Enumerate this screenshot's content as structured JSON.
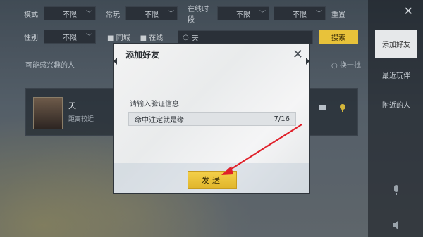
{
  "filters": {
    "row1": [
      {
        "label": "模式",
        "value": "不限"
      },
      {
        "label": "常玩",
        "value": "不限"
      },
      {
        "label": "在线时段",
        "value": "不限"
      },
      {
        "label": "",
        "value": "不限"
      }
    ],
    "reset_label": "重置",
    "row2": {
      "label": "性别",
      "value": "不限",
      "check1": "同城",
      "check2": "在线"
    },
    "search": {
      "value": "天"
    },
    "search_button": "搜索",
    "people_label": "可能感兴趣的人",
    "refresh_label": "换一批"
  },
  "sidebar": {
    "items": [
      {
        "label": "添加好友",
        "active": true
      },
      {
        "label": "最近玩伴",
        "active": false
      },
      {
        "label": "附近的人",
        "active": false
      }
    ]
  },
  "card": {
    "name": "天",
    "status": "距离较近"
  },
  "modal": {
    "title": "添加好友",
    "prompt": "请输入验证信息",
    "input_value": "命中注定就是缘",
    "char_count": "7/16",
    "send_label": "发送"
  },
  "colors": {
    "accent": "#e8c23a",
    "arrow": "#e0202a"
  }
}
